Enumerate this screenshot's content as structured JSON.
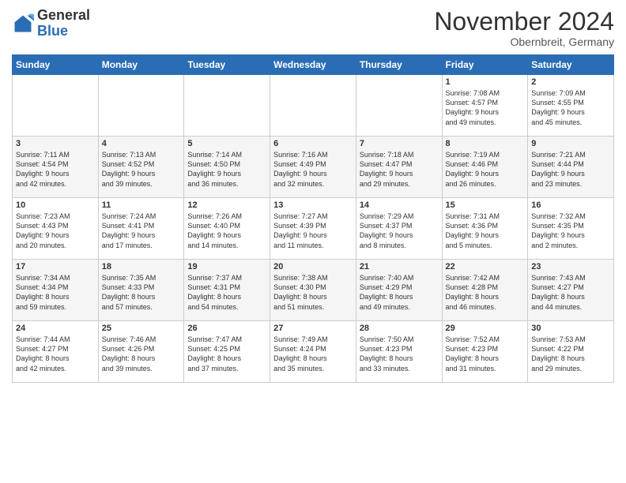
{
  "logo": {
    "general": "General",
    "blue": "Blue"
  },
  "header": {
    "month": "November 2024",
    "location": "Obernbreit, Germany"
  },
  "weekdays": [
    "Sunday",
    "Monday",
    "Tuesday",
    "Wednesday",
    "Thursday",
    "Friday",
    "Saturday"
  ],
  "weeks": [
    [
      {
        "day": "",
        "info": ""
      },
      {
        "day": "",
        "info": ""
      },
      {
        "day": "",
        "info": ""
      },
      {
        "day": "",
        "info": ""
      },
      {
        "day": "",
        "info": ""
      },
      {
        "day": "1",
        "info": "Sunrise: 7:08 AM\nSunset: 4:57 PM\nDaylight: 9 hours\nand 49 minutes."
      },
      {
        "day": "2",
        "info": "Sunrise: 7:09 AM\nSunset: 4:55 PM\nDaylight: 9 hours\nand 45 minutes."
      }
    ],
    [
      {
        "day": "3",
        "info": "Sunrise: 7:11 AM\nSunset: 4:54 PM\nDaylight: 9 hours\nand 42 minutes."
      },
      {
        "day": "4",
        "info": "Sunrise: 7:13 AM\nSunset: 4:52 PM\nDaylight: 9 hours\nand 39 minutes."
      },
      {
        "day": "5",
        "info": "Sunrise: 7:14 AM\nSunset: 4:50 PM\nDaylight: 9 hours\nand 36 minutes."
      },
      {
        "day": "6",
        "info": "Sunrise: 7:16 AM\nSunset: 4:49 PM\nDaylight: 9 hours\nand 32 minutes."
      },
      {
        "day": "7",
        "info": "Sunrise: 7:18 AM\nSunset: 4:47 PM\nDaylight: 9 hours\nand 29 minutes."
      },
      {
        "day": "8",
        "info": "Sunrise: 7:19 AM\nSunset: 4:46 PM\nDaylight: 9 hours\nand 26 minutes."
      },
      {
        "day": "9",
        "info": "Sunrise: 7:21 AM\nSunset: 4:44 PM\nDaylight: 9 hours\nand 23 minutes."
      }
    ],
    [
      {
        "day": "10",
        "info": "Sunrise: 7:23 AM\nSunset: 4:43 PM\nDaylight: 9 hours\nand 20 minutes."
      },
      {
        "day": "11",
        "info": "Sunrise: 7:24 AM\nSunset: 4:41 PM\nDaylight: 9 hours\nand 17 minutes."
      },
      {
        "day": "12",
        "info": "Sunrise: 7:26 AM\nSunset: 4:40 PM\nDaylight: 9 hours\nand 14 minutes."
      },
      {
        "day": "13",
        "info": "Sunrise: 7:27 AM\nSunset: 4:39 PM\nDaylight: 9 hours\nand 11 minutes."
      },
      {
        "day": "14",
        "info": "Sunrise: 7:29 AM\nSunset: 4:37 PM\nDaylight: 9 hours\nand 8 minutes."
      },
      {
        "day": "15",
        "info": "Sunrise: 7:31 AM\nSunset: 4:36 PM\nDaylight: 9 hours\nand 5 minutes."
      },
      {
        "day": "16",
        "info": "Sunrise: 7:32 AM\nSunset: 4:35 PM\nDaylight: 9 hours\nand 2 minutes."
      }
    ],
    [
      {
        "day": "17",
        "info": "Sunrise: 7:34 AM\nSunset: 4:34 PM\nDaylight: 8 hours\nand 59 minutes."
      },
      {
        "day": "18",
        "info": "Sunrise: 7:35 AM\nSunset: 4:33 PM\nDaylight: 8 hours\nand 57 minutes."
      },
      {
        "day": "19",
        "info": "Sunrise: 7:37 AM\nSunset: 4:31 PM\nDaylight: 8 hours\nand 54 minutes."
      },
      {
        "day": "20",
        "info": "Sunrise: 7:38 AM\nSunset: 4:30 PM\nDaylight: 8 hours\nand 51 minutes."
      },
      {
        "day": "21",
        "info": "Sunrise: 7:40 AM\nSunset: 4:29 PM\nDaylight: 8 hours\nand 49 minutes."
      },
      {
        "day": "22",
        "info": "Sunrise: 7:42 AM\nSunset: 4:28 PM\nDaylight: 8 hours\nand 46 minutes."
      },
      {
        "day": "23",
        "info": "Sunrise: 7:43 AM\nSunset: 4:27 PM\nDaylight: 8 hours\nand 44 minutes."
      }
    ],
    [
      {
        "day": "24",
        "info": "Sunrise: 7:44 AM\nSunset: 4:27 PM\nDaylight: 8 hours\nand 42 minutes."
      },
      {
        "day": "25",
        "info": "Sunrise: 7:46 AM\nSunset: 4:26 PM\nDaylight: 8 hours\nand 39 minutes."
      },
      {
        "day": "26",
        "info": "Sunrise: 7:47 AM\nSunset: 4:25 PM\nDaylight: 8 hours\nand 37 minutes."
      },
      {
        "day": "27",
        "info": "Sunrise: 7:49 AM\nSunset: 4:24 PM\nDaylight: 8 hours\nand 35 minutes."
      },
      {
        "day": "28",
        "info": "Sunrise: 7:50 AM\nSunset: 4:23 PM\nDaylight: 8 hours\nand 33 minutes."
      },
      {
        "day": "29",
        "info": "Sunrise: 7:52 AM\nSunset: 4:23 PM\nDaylight: 8 hours\nand 31 minutes."
      },
      {
        "day": "30",
        "info": "Sunrise: 7:53 AM\nSunset: 4:22 PM\nDaylight: 8 hours\nand 29 minutes."
      }
    ]
  ]
}
